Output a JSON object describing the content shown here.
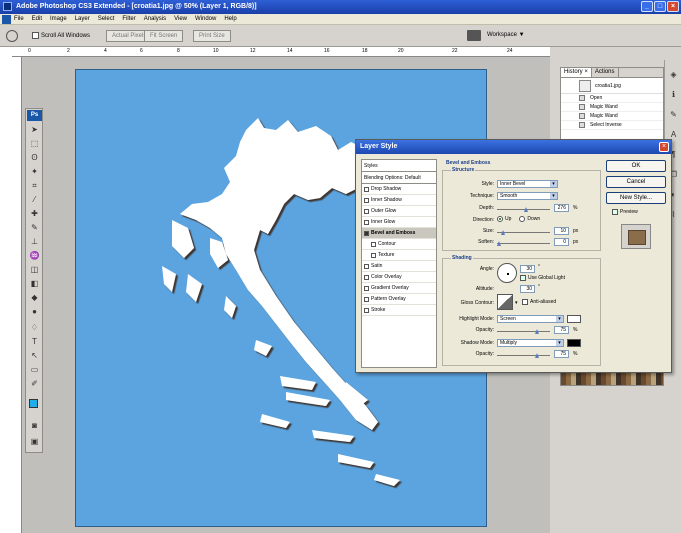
{
  "app": {
    "title": "Adobe Photoshop CS3 Extended - [croatia1.jpg @ 50% (Layer 1, RGB/8)]"
  },
  "menubar": {
    "items": [
      "File",
      "Edit",
      "Image",
      "Layer",
      "Select",
      "Filter",
      "Analysis",
      "View",
      "Window",
      "Help"
    ]
  },
  "options": {
    "scroll_all_label": "Scroll All Windows",
    "actual_pixels": "Actual Pixels",
    "fit_screen": "Fit Screen",
    "print_size": "Print Size",
    "workspace": "Workspace ▼"
  },
  "ruler": {
    "ticks": [
      "0",
      "2",
      "4",
      "6",
      "8",
      "10",
      "12",
      "14",
      "16",
      "18",
      "20",
      "22",
      "24"
    ]
  },
  "history": {
    "tabs": [
      "History ×",
      "Actions"
    ],
    "snapshot": "croatia1.jpg",
    "items": [
      "Open",
      "Magic Wand",
      "Magic Wand",
      "Select Inverse"
    ]
  },
  "dialog": {
    "title": "Layer Style",
    "styles_header": "Styles",
    "blending_label": "Blending Options: Default",
    "styles": [
      {
        "label": "Drop Shadow",
        "checked": false
      },
      {
        "label": "Inner Shadow",
        "checked": false
      },
      {
        "label": "Outer Glow",
        "checked": false
      },
      {
        "label": "Inner Glow",
        "checked": false
      },
      {
        "label": "Bevel and Emboss",
        "checked": true,
        "selected": true
      },
      {
        "label": "Contour",
        "checked": false,
        "sub": true
      },
      {
        "label": "Texture",
        "checked": false,
        "sub": true
      },
      {
        "label": "Satin",
        "checked": false
      },
      {
        "label": "Color Overlay",
        "checked": false
      },
      {
        "label": "Gradient Overlay",
        "checked": false
      },
      {
        "label": "Pattern Overlay",
        "checked": false
      },
      {
        "label": "Stroke",
        "checked": false
      }
    ],
    "bevel_title": "Bevel and Emboss",
    "structure": {
      "title": "Structure",
      "style_label": "Style:",
      "style_value": "Inner Bevel",
      "technique_label": "Technique:",
      "technique_value": "Smooth",
      "depth_label": "Depth:",
      "depth_value": "276",
      "depth_unit": "%",
      "direction_label": "Direction:",
      "direction_up": "Up",
      "direction_down": "Down",
      "size_label": "Size:",
      "size_value": "10",
      "size_unit": "px",
      "soften_label": "Soften:",
      "soften_value": "0",
      "soften_unit": "px"
    },
    "shading": {
      "title": "Shading",
      "angle_label": "Angle:",
      "angle_value": "30",
      "angle_unit": "°",
      "global_light_label": "Use Global Light",
      "altitude_label": "Altitude:",
      "altitude_value": "30",
      "altitude_unit": "°",
      "gloss_label": "Gloss Contour:",
      "antialiased_label": "Anti-aliased",
      "highlight_label": "Highlight Mode:",
      "highlight_value": "Screen",
      "h_opacity_label": "Opacity:",
      "h_opacity_value": "75",
      "h_opacity_unit": "%",
      "shadow_label": "Shadow Mode:",
      "shadow_value": "Multiply",
      "s_opacity_label": "Opacity:",
      "s_opacity_value": "75",
      "s_opacity_unit": "%"
    },
    "buttons": {
      "ok": "OK",
      "cancel": "Cancel",
      "new_style": "New Style...",
      "preview": "Preview"
    }
  },
  "colors": {
    "canvas": "#5ba4df",
    "map": "#ffffff",
    "foreground": "#1faee9",
    "dialog_bg": "#ece9d8"
  }
}
